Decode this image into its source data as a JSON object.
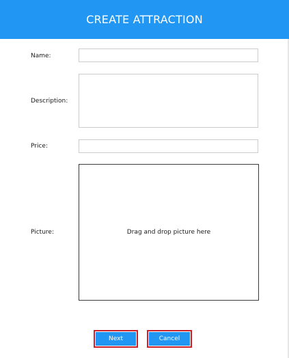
{
  "header": {
    "title": "CREATE ATTRACTION"
  },
  "form": {
    "name_label": "Name:",
    "name_value": "",
    "description_label": "Description:",
    "description_value": "",
    "price_label": "Price:",
    "price_value": "",
    "picture_label": "Picture:",
    "picture_hint": "Drag and drop picture here"
  },
  "actions": {
    "next_label": "Next",
    "cancel_label": "Cancel"
  },
  "colors": {
    "accent": "#2196f3",
    "highlight_border": "#cc1f2a"
  }
}
